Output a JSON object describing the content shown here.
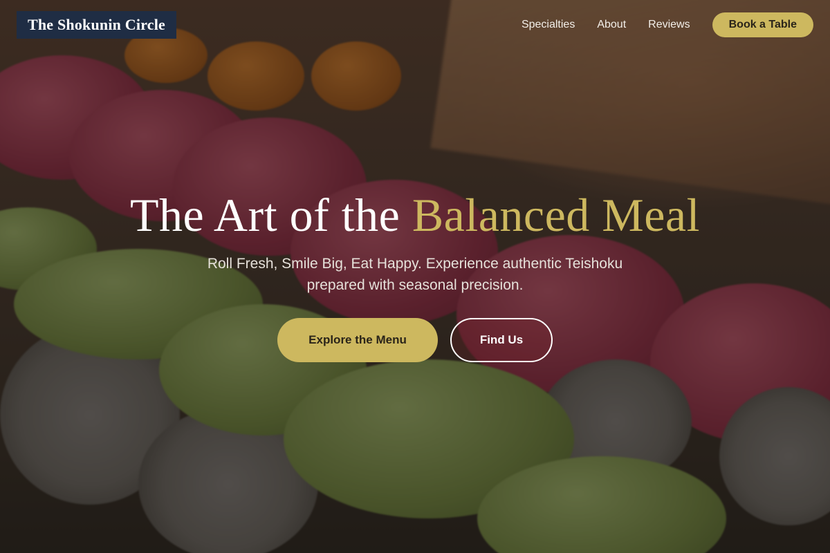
{
  "header": {
    "brand": "The Shokunin Circle",
    "nav": [
      {
        "label": "Specialties"
      },
      {
        "label": "About"
      },
      {
        "label": "Reviews"
      }
    ],
    "cta_label": "Book a Table"
  },
  "hero": {
    "title_prefix": "The Art of the ",
    "title_accent": "Balanced Meal",
    "subtitle": "Roll Fresh, Smile Big, Eat Happy. Experience authentic Teishoku prepared with seasonal precision.",
    "primary_button": "Explore the Menu",
    "secondary_button": "Find Us",
    "background_image": "sushi-rolls-photo"
  },
  "colors": {
    "accent": "#cdb85f",
    "brand_bg": "#1f2d44",
    "text_light": "#ffffff"
  }
}
